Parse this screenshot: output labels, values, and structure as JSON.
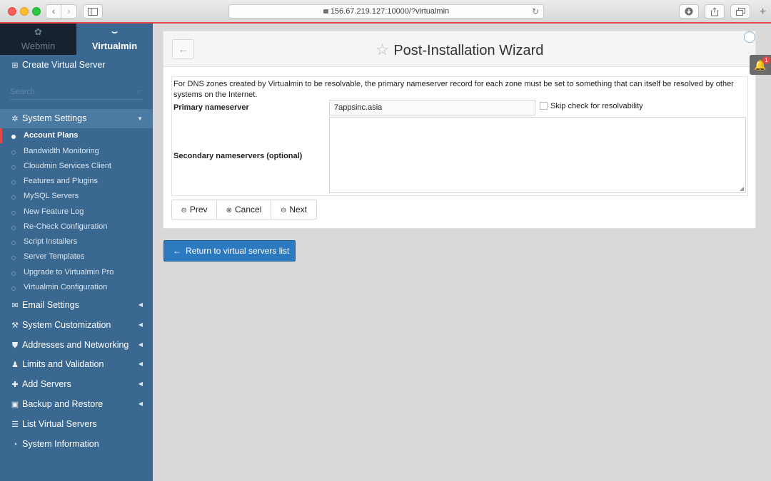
{
  "browser": {
    "url": "156.67.219.127:10000/?virtualmin",
    "back_glyph": "‹",
    "forward_glyph": "›",
    "new_tab_glyph": "+"
  },
  "sidebar": {
    "tabs": [
      {
        "label": "Webmin",
        "icon": "webmin-logo-icon"
      },
      {
        "label": "Virtualmin",
        "icon": "virtualmin-logo-icon"
      }
    ],
    "create_label": "Create Virtual Server",
    "search_placeholder": "Search",
    "system_settings_label": "System Settings",
    "sub_items": [
      "Account Plans",
      "Bandwidth Monitoring",
      "Cloudmin Services Client",
      "Features and Plugins",
      "MySQL Servers",
      "New Feature Log",
      "Re-Check Configuration",
      "Script Installers",
      "Server Templates",
      "Upgrade to Virtualmin Pro",
      "Virtualmin Configuration"
    ],
    "sections": [
      {
        "label": "Email Settings",
        "icon": "envelope-icon"
      },
      {
        "label": "System Customization",
        "icon": "wrench-icon"
      },
      {
        "label": "Addresses and Networking",
        "icon": "shield-icon"
      },
      {
        "label": "Limits and Validation",
        "icon": "users-icon"
      },
      {
        "label": "Add Servers",
        "icon": "plus-icon"
      },
      {
        "label": "Backup and Restore",
        "icon": "floppy-icon"
      },
      {
        "label": "List Virtual Servers",
        "icon": "list-icon"
      },
      {
        "label": "System Information",
        "icon": "dashboard-icon"
      }
    ]
  },
  "panel": {
    "title": "Post-Installation Wizard",
    "description": "For DNS zones created by Virtualmin to be resolvable, the primary nameserver record for each zone must be set to something that can itself be resolved by other systems on the Internet.",
    "primary_label": "Primary nameserver",
    "primary_value": "7appsinc.asia",
    "skip_label": "Skip check for resolvability",
    "secondary_label": "Secondary nameservers (optional)",
    "buttons": {
      "prev": "Prev",
      "cancel": "Cancel",
      "next": "Next"
    },
    "return_label": "Return to virtual servers list"
  },
  "notifications": {
    "count": "1"
  },
  "colors": {
    "sidebar_bg": "#3a6890",
    "accent_red": "#e54848",
    "primary_button": "#2d79c0"
  }
}
